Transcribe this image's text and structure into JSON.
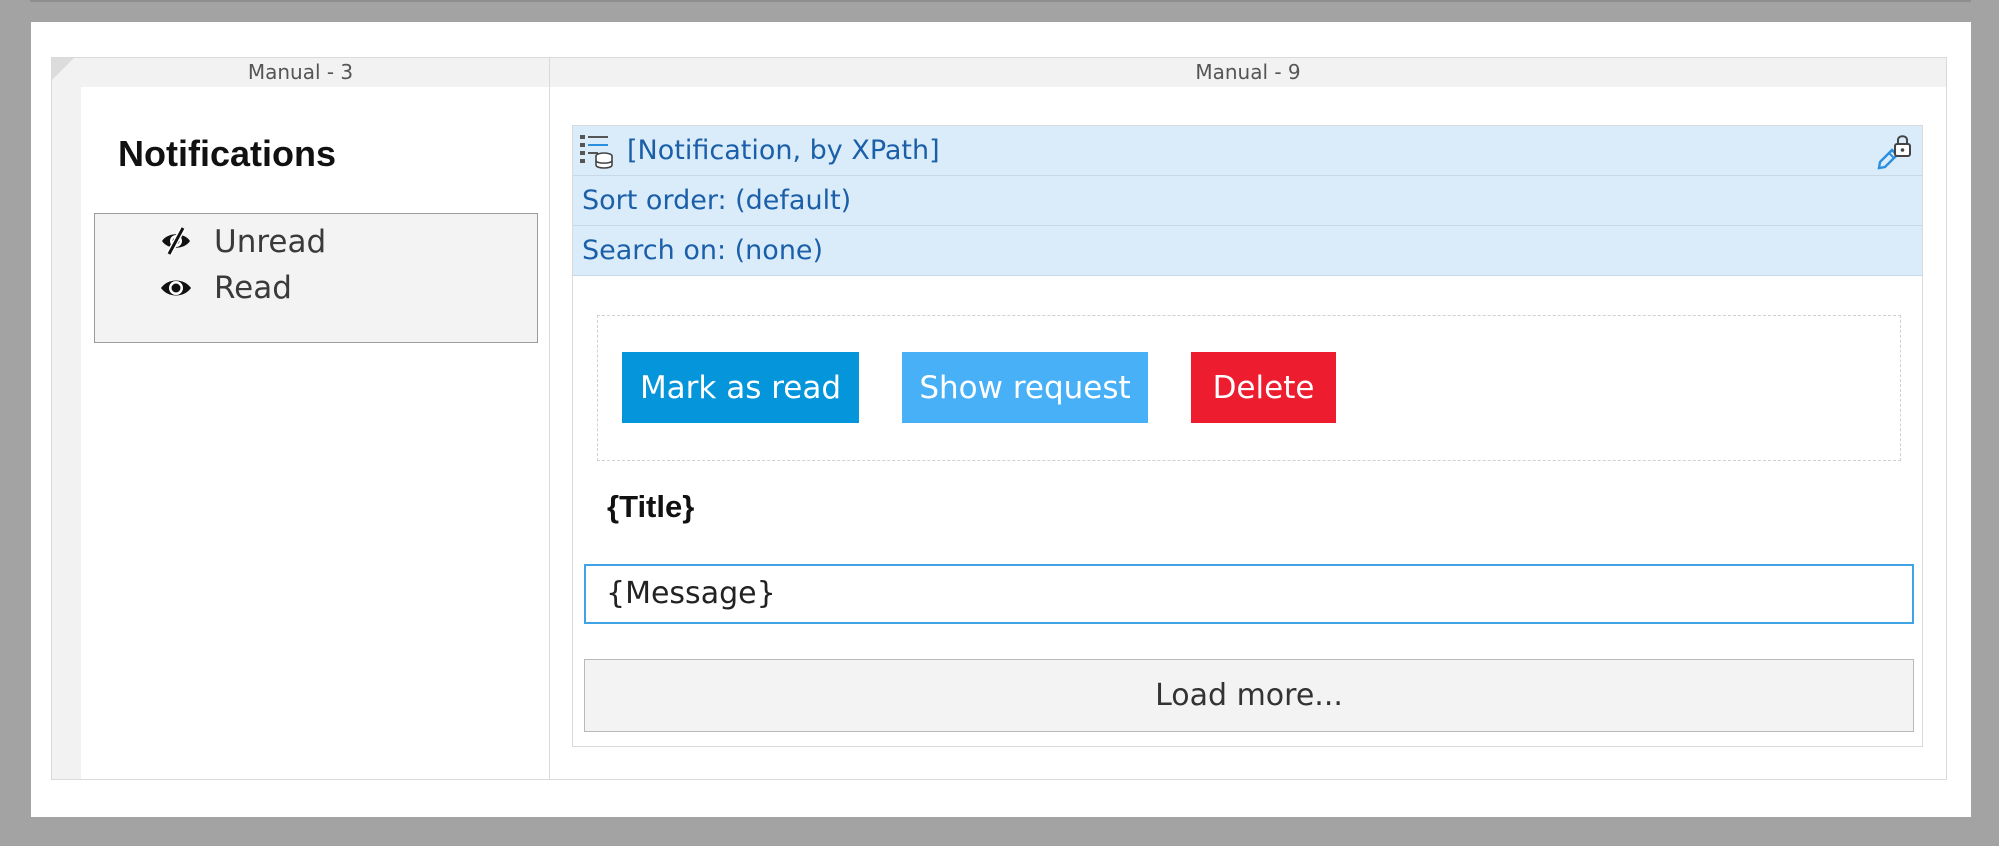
{
  "layout_grid": {
    "left_column_header": "Manual - 3",
    "right_column_header": "Manual - 9"
  },
  "left_panel": {
    "title": "Notifications",
    "nav_items": [
      {
        "label": "Unread",
        "icon": "eye-slash-icon"
      },
      {
        "label": "Read",
        "icon": "eye-icon"
      }
    ]
  },
  "list_view": {
    "datasource_label": "[Notification, by XPath]",
    "sort_order_label": "Sort order: (default)",
    "search_on_label": "Search on: (none)",
    "icons": {
      "datasource": "listview-database-icon",
      "lock": "edit-lock-icon"
    },
    "buttons": {
      "mark_as_read": "Mark as read",
      "show_request": "Show request",
      "delete": "Delete"
    },
    "title_field": "{Title}",
    "message_field": "{Message}",
    "load_more_label": "Load more..."
  },
  "colors": {
    "primary": "#0595db",
    "info": "#48b0f7",
    "danger": "#ed1c2e",
    "header_bg": "#daecfa",
    "header_text": "#1a5fa8",
    "focus_border": "#3fa3e6"
  }
}
